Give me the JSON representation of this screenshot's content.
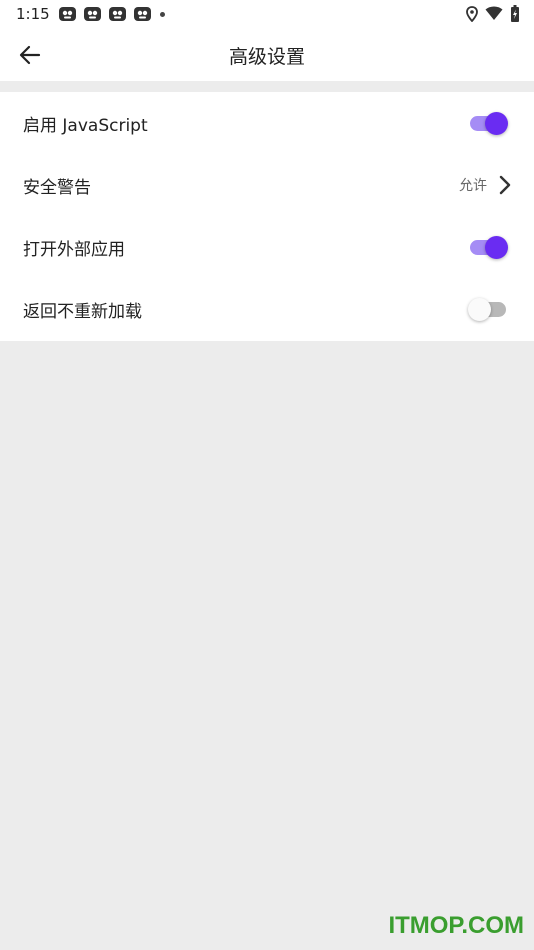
{
  "status_bar": {
    "time": "1:15"
  },
  "toolbar": {
    "title": "高级设置"
  },
  "settings": [
    {
      "label": "启用 JavaScript",
      "type": "switch",
      "checked": true
    },
    {
      "label": "安全警告",
      "type": "link",
      "value": "允许"
    },
    {
      "label": "打开外部应用",
      "type": "switch",
      "checked": true
    },
    {
      "label": "返回不重新加载",
      "type": "switch",
      "checked": false
    }
  ],
  "colors": {
    "accent": "#6a2cf2",
    "accent_track": "#a58cf5",
    "background": "#ececec"
  },
  "watermark": "ITMOP.COM"
}
